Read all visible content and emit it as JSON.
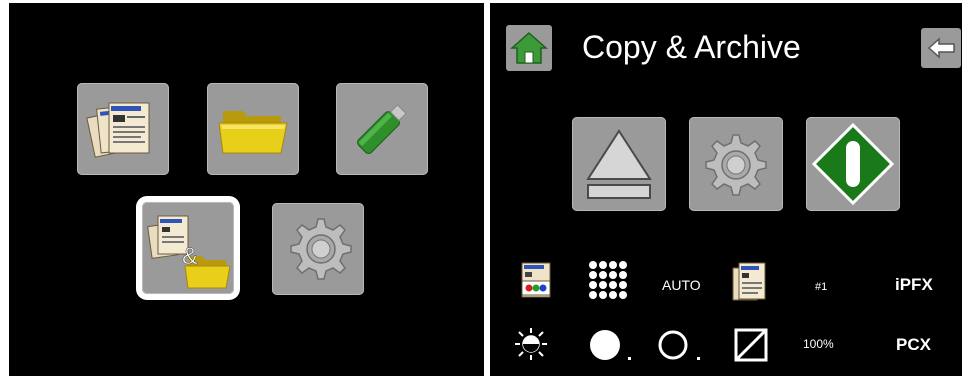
{
  "left_menu": {
    "tiles": [
      {
        "icon": "copy-documents-icon"
      },
      {
        "icon": "folder-icon"
      },
      {
        "icon": "usb-drive-icon"
      },
      {
        "icon": "copy-and-archive-icon",
        "selected": true
      },
      {
        "icon": "settings-gear-icon"
      }
    ]
  },
  "right_screen": {
    "title": "Copy & Archive",
    "home_icon": "home-icon",
    "back_icon": "back-arrow-icon",
    "actions": [
      {
        "icon": "eject-icon"
      },
      {
        "icon": "settings-gear-icon"
      },
      {
        "icon": "start-icon"
      }
    ],
    "status_row1": {
      "color_mode_icon": "color-mode-icon",
      "resolution_icon": "resolution-grid-icon",
      "auto_label": "AUTO",
      "original_icon": "original-document-icon",
      "copies_label": "#1",
      "format_label": "iPFX"
    },
    "status_row2": {
      "brightness_icon": "brightness-icon",
      "fill_icon": "solid-circle-icon",
      "outline_icon": "outline-circle-icon",
      "contrast_icon": "contrast-icon",
      "zoom_label": "100%",
      "format_label": "PCX"
    }
  },
  "colors": {
    "background": "#000000",
    "tile_gray": "#9a9a9a",
    "folder_yellow": "#e8cf1a",
    "usb_green": "#2f8f2a",
    "start_green": "#1a7a1a",
    "text": "#ffffff"
  }
}
